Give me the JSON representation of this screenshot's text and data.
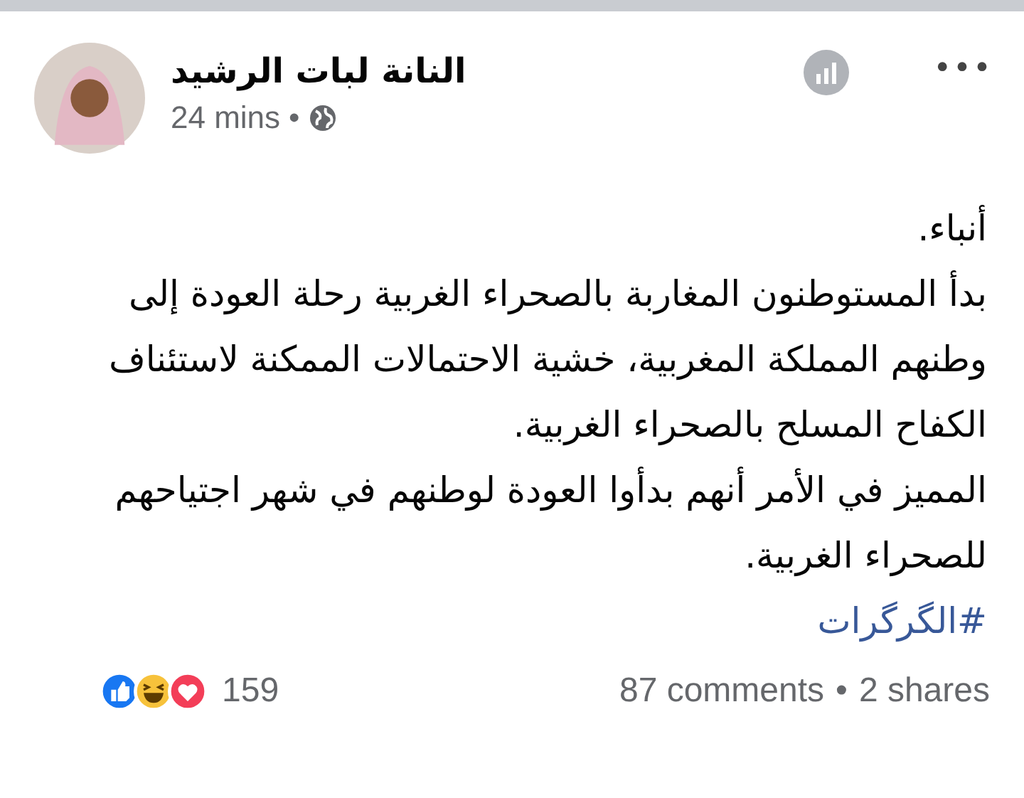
{
  "post": {
    "author": "النانة لبات الرشيد",
    "time": "24 mins",
    "separator": "•",
    "paragraphs": [
      "أنباء.",
      "بدأ المستوطنون المغاربة بالصحراء الغربية رحلة العودة إلى وطنهم المملكة المغربية، خشية الاحتمالات الممكنة لاستئناف الكفاح المسلح بالصحراء الغربية.",
      "المميز في الأمر أنهم بدأوا العودة لوطنهم في شهر اجتياحهم للصحراء الغربية."
    ],
    "hashtag": "#الگرگرات",
    "menu": "•••"
  },
  "footer": {
    "reaction_count": "159",
    "comments": "87 comments",
    "separator": "•",
    "shares": "2 shares"
  }
}
